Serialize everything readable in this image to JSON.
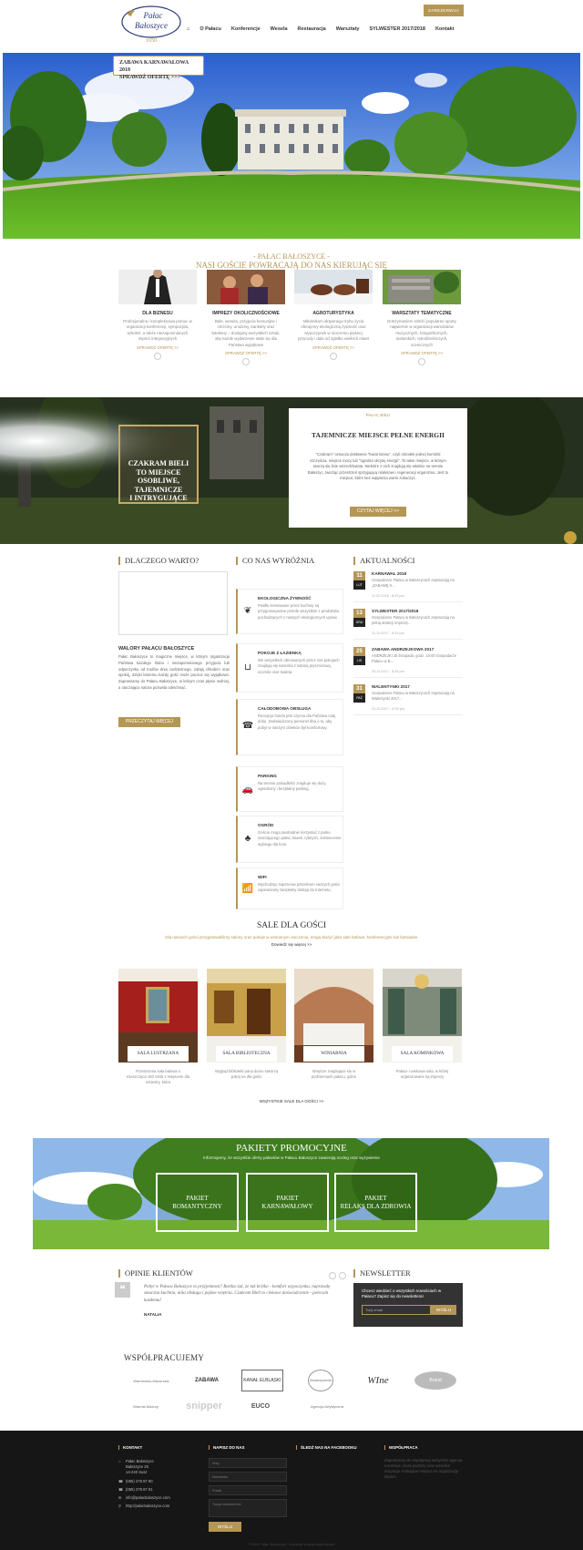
{
  "header": {
    "logo_line1": "Pałac",
    "logo_line2": "Bałoszyce",
    "logo_year": "1650",
    "nav": [
      "O Pałacu",
      "Konferencje",
      "Wesela",
      "Restauracja",
      "Warsztaty",
      "SYLWESTER 2017/2018",
      "Kontakt"
    ],
    "reserve_label": "ZAREZERWUJ"
  },
  "hero": {
    "promo_line1": "ZABAWA KARNAWAŁOWA 2018",
    "promo_line2": "SPRAWDŹ OFERTĘ >>>"
  },
  "intro": {
    "title": "- PAŁAC BAŁOSZYCE -",
    "subtitle": "NASI GOŚCIE POWRACAJĄ DO NAS KIERUJĄC SIĘ"
  },
  "offers": [
    {
      "title": "DLA BIZNESU",
      "text": "Profesjonalna i kompleksowa pomoc w organizacji konferencji, sympozjów, szkoleń, a także niezapomnianych imprez integracyjnych",
      "more": "SPRAWDŹ OFERTĘ >>"
    },
    {
      "title": "IMPREZY OKOLICZNOŚCIOWE",
      "text": "Bale, wesela, przyjęcia komunijne i chrzciny, urodziny, bankiety oraz bankiety – dostępny wszystkich sztuki, aby każde wydarzenie stało się dla Państwa wyjątkowe",
      "more": "SPRAWDŹ OFERTĘ >>"
    },
    {
      "title": "AGROTURYSTYKA",
      "text": "Miłośnikom aktywnego trybu życia oferujemy ekologiczną żywność oraz wypoczynek w otoczeniu pięknej przyrody i dala od zgiełku wielkich miast",
      "more": "SPRAWDŹ OFERTĘ >>"
    },
    {
      "title": "WARSZTATY TEMATYCZNE",
      "text": "Dotrzymaniem szkół i popularne sporty najwiernie w organizacji warsztatów muzycznych, fotograficznych, malarskich, rękodzielniczych, scenicznych",
      "more": "SPRAWDŹ OFERTĘ >>"
    }
  ],
  "czakram": {
    "lines": [
      "CZAKRAM BIELI",
      "TO MIEJSCE",
      "OSOBLIWE,",
      "TAJEMNICZE",
      "I INTRYGUJĄCE"
    ]
  },
  "secret": {
    "tag": "PAŁAC BIELI",
    "title": "TAJEMNICZE MIEJSCE PEŁNE ENERGII",
    "text": "\"Czakram\" oznacza dosłownie \"kwiat lotosu\", czyli ośrodek jednej komórki szczęścia, miejsce mocy lub \"ognisko ukrytej energii\". To takie miejsce, w którym tworzą się linie wszechświata. Niektóre z nich znajdują się właśnie na terenie Bałoszyc, tworząc przestrzeń sprzyjającą relaksowi i regeneracji organizmu. Jest to miejsce, które bez wątpienia warto zobaczyć.",
    "button": "CZYTAJ WIĘCEJ >>"
  },
  "why": {
    "heading": "DLACZEGO WARTO?",
    "subheading": "WALORY PAŁACU BAŁOSZYCE",
    "text": "Pałac Bałoszyce to magiczne miejsce, w którym organizacja Państwa każdego ślubu i niezapomnianego przyjęcia lub odpoczynku od trudów dnia codziennego, zabiją chłodem oraz spokój, dzięki któremu każdy gość może poczuć się wyjątkowo. Zapraszamy do Pałacu Bałoszyce, w którym czas płynie wolniej, a otaczająca natura pozwala odetchnąć.",
    "button": "PRZECZYTAJ WIĘCEJ"
  },
  "features": {
    "heading": "CO NAS WYRÓŻNIA",
    "items": [
      {
        "icon": "leaf-icon",
        "title": "EKOLOGICZNA ŻYWNOŚĆ",
        "text": "Posiłki serwowane przez kuchnię są przygotowywane przede wszystkim z produktów pochodzących z naszych ekologicznych upraw."
      },
      {
        "icon": "bathtub-icon",
        "title": "POKOJE Z ŁAZIENKĄ",
        "text": "We wszystkich oferowanych przez nas pokojach znajdują się łazienka z kabiną prysznicową, ręczniki oraz toaleta."
      },
      {
        "icon": "phone-icon",
        "title": "CAŁODOBOWA OBSŁUGA",
        "text": "Recepcja hotelu jest czynna dla Państwa całą dobę. Doświadczony personel dba o to, aby pobyt w naszym obiekcie był komfortowy."
      },
      {
        "icon": "car-icon",
        "title": "PARKING",
        "text": "Na terenie posiadłości znajduje się duży, ogrodzony i bezpłatny parking."
      },
      {
        "icon": "tree-icon",
        "title": "OGRÓD",
        "text": "Goście mogą swobodnie korzystać z parku otaczającego pałac, ławek, rybnych, zaśmiecenie wybiegu dla koni."
      },
      {
        "icon": "wifi-icon",
        "title": "WIFI",
        "text": "Wychodząc naprzeciw potrzebom naszych gości zapewniamy bezpłatny dostęp do Internetu."
      }
    ]
  },
  "news": {
    "heading": "AKTUALNOŚCI",
    "items": [
      {
        "day": "11",
        "month": "LUT",
        "title": "KARNAWAŁ 2018",
        "text": "Gospodarze Pałacu w Bałoszycach zapraszają na „ZABAWĘ K...",
        "meta": "11.02.2018 - 8:33 pm"
      },
      {
        "day": "13",
        "month": "GRU",
        "title": "SYLWESTER 2017/2018",
        "text": "Gospodarze Pałacu w Bałoszycach zapraszają na pełną atrakcji imprezę...",
        "meta": "11.12.2017 - 8:33 pm"
      },
      {
        "day": "25",
        "month": "LIS",
        "title": "ZABAWA ANDRZEJKOWA 2017",
        "text": "ANDRZEJKI 25 listopada, godz. 19:00 Gospodarze Pałacu w B...",
        "meta": "25.11.2017 - 8:33 pm"
      },
      {
        "day": "31",
        "month": "PAŹ",
        "title": "WALENTYNKI 2017",
        "text": "Gospodarze Pałacu w Bałoszycach zapraszają na Walentynki 2017...",
        "meta": "31.10.2017 - 8:33 pm"
      }
    ]
  },
  "rooms": {
    "title": "SALE DLA GOŚCI",
    "subtitle": "Dla naszych gości przygotowaliśmy salony oraz pokoje w ustronnym otoczeniu, mogą służyć jako sale balowe, konferencyjne lub biesiadne",
    "link": "Dowiedz się więcej >>",
    "items": [
      {
        "name": "SALA LUSTRZANA",
        "text": "Przestronna sala balowa o mieszcząca 150 osób z miejscem dla orkiestry, która"
      },
      {
        "name": "SALA BIBLIOTECZNA",
        "text": "Wygląd biblioteki pana domu stworzą pokój na dla gości"
      },
      {
        "name": "WINIARNIA",
        "text": "Wnętrze znajdujące się w podziemiach pałacu, gdzie"
      },
      {
        "name": "SALA KOMINKOWA",
        "text": "Pałace i wiekowa sala, w której organizowane są imprezy"
      }
    ],
    "all_link": "WSZYSTKIE SALE DLA GOŚCI >>"
  },
  "packages": {
    "title": "PAKIETY PROMOCYJNE",
    "subtitle": "Informujemy, że wszystkie oferty pakietów w Pałacu Bałoszyce zawierają nocleg oraz wyżywienie",
    "items": [
      {
        "line1": "PAKIET",
        "line2": "ROMANTYCZNY"
      },
      {
        "line1": "PAKIET",
        "line2": "KARNAWAŁOWY"
      },
      {
        "line1": "PAKIET",
        "line2": "RELAKS DLA ZDROWIA"
      }
    ]
  },
  "opinions": {
    "heading": "OPINIE KLIENTÓW",
    "quote": "Pobyt w Pałacu Bałoszyce to przyjemność! Bardzo żal, że tak krótko - komfort wypoczynku, naprawdę smaczna kuchnia, miła obsługa i piękne wnętrza. Czakram Bieli to ciekawe doświadczenie - polecam każdemu!",
    "author": "NATALIA"
  },
  "newsletter": {
    "heading": "NEWSLETTER",
    "text": "Chcesz wiedzieć o wszystkich nowościach w Pałacu? Zapisz się do newslettera!",
    "placeholder": "Twój email",
    "button": "WYŚLIJ"
  },
  "partners": {
    "heading": "WSPÓŁPRACUJEMY",
    "logos": [
      "Warmińsko-Mazurskie",
      "ZABAWA",
      "KANAŁ ELBLĄSKI",
      "Stowarzyszenie",
      "WIne",
      "Brand",
      "Warmia Mazury",
      "snipper",
      "EUCO",
      "Agencja Artystyczna"
    ]
  },
  "footer": {
    "contact": {
      "heading": "KONTAKT",
      "lines": [
        "Pałac Bałoszyce",
        "Bałoszyce 25",
        "14-240 Susz",
        "(055) 278 87 90",
        "(055) 278 87 91",
        "info@palacbaloszyce.com",
        "http://palacbaloszyce.com"
      ]
    },
    "write": {
      "heading": "NAPISZ DO NAS",
      "fields": [
        "Imię",
        "Nazwisko",
        "Email",
        "Twoja wiadomość"
      ],
      "button": "WYŚLIJ"
    },
    "facebook": {
      "heading": "ŚLEDŹ NAS NA FACEBOOKU"
    },
    "cooperation": {
      "heading": "WSPÓŁPRACA",
      "text": "Zapraszamy do współpracy wszystkie agencje eventowe, biura podróży oraz wszelkie instytucje szukające miejsca na organizację imprez."
    },
    "copyright": "© 2018 Pałac Bałoszyce. Wszelkie prawa zastrzeżone."
  }
}
